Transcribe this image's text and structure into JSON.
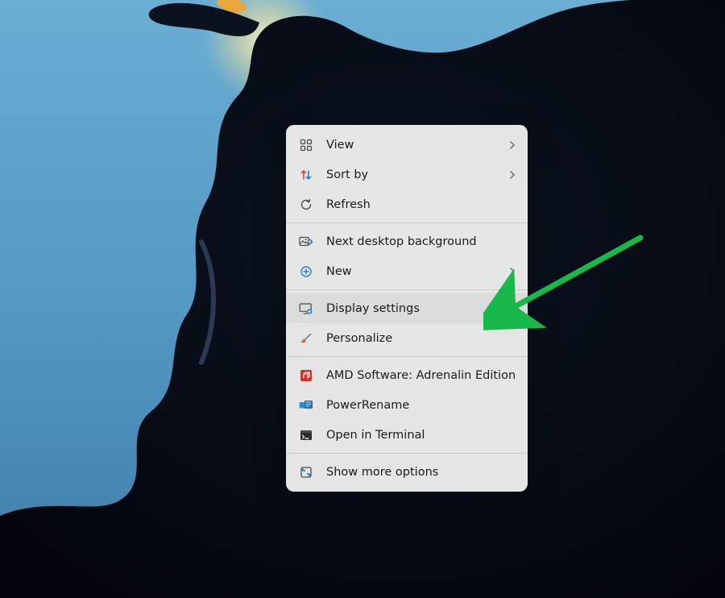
{
  "context_menu": {
    "items": [
      {
        "label": "View",
        "has_submenu": true
      },
      {
        "label": "Sort by",
        "has_submenu": true
      },
      {
        "label": "Refresh",
        "has_submenu": false
      },
      {
        "label": "Next desktop background",
        "has_submenu": false
      },
      {
        "label": "New",
        "has_submenu": true
      },
      {
        "label": "Display settings",
        "has_submenu": false,
        "highlighted": true
      },
      {
        "label": "Personalize",
        "has_submenu": false
      },
      {
        "label": "AMD Software: Adrenalin Edition",
        "has_submenu": false
      },
      {
        "label": "PowerRename",
        "has_submenu": false
      },
      {
        "label": "Open in Terminal",
        "has_submenu": false
      },
      {
        "label": "Show more options",
        "has_submenu": false
      }
    ]
  },
  "annotation": {
    "arrow_color": "#18b84a"
  }
}
